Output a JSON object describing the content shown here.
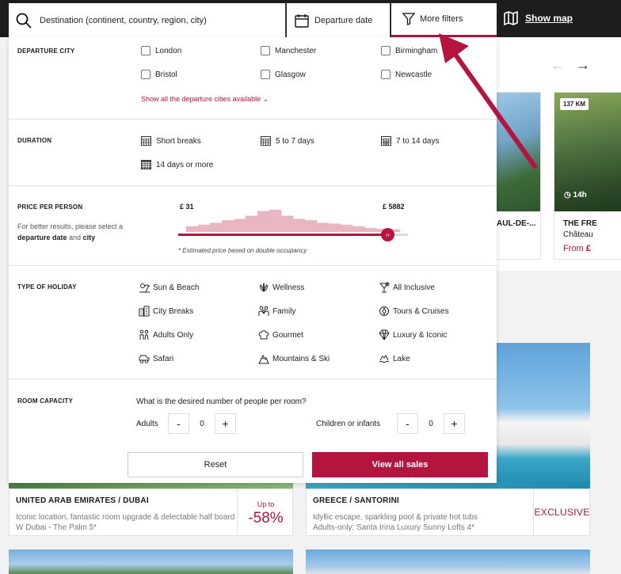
{
  "header": {
    "search_placeholder": "Destination (continent, country, region, city)",
    "departure_date": "Departure date",
    "more_filters": "More filters",
    "show_map": "Show map"
  },
  "background": {
    "card_a_title": "AUL-DE-...",
    "card_b_badge": "137 KM",
    "card_b_duration": "14h",
    "card_b_title": "THE FRE",
    "card_b_sub": "Château",
    "card_b_from": "From",
    "card_b_currency": "£",
    "deals": [
      {
        "location": "UNITED ARAB EMIRATES / DUBAI",
        "desc_line1": "Iconic location, fantastic room upgrade & delectable half board",
        "desc_line2": "W Dubai - The Palm 5*",
        "tag_small": "Up to",
        "tag_big": "-58%"
      },
      {
        "location": "GREECE / SANTORINI",
        "desc_line1": "Idyllic escape, sparkling pool & private hot tubs",
        "desc_line2": "Adults-only: Santa Irina Luxury Sunny Lofts 4*",
        "tag": "EXCLUSIVE"
      }
    ]
  },
  "filters": {
    "departure": {
      "title": "DEPARTURE CITY",
      "cities": [
        "London",
        "Manchester",
        "Birmingham",
        "Bristol",
        "Glasgow",
        "Newcastle"
      ],
      "show_all": "Show all the departure cities available"
    },
    "duration": {
      "title": "DURATION",
      "options": [
        "Short breaks",
        "5 to 7 days",
        "7 to 14 days",
        "14 days or more"
      ]
    },
    "price": {
      "title": "PRICE PER PERSON",
      "note_line1": "For better results, please select a",
      "note_bold1": "departure date",
      "note_and": "and",
      "note_bold2": "city",
      "min": "£ 31",
      "max": "£ 5882",
      "slider_max_fraction": 0.91,
      "histogram": [
        0.22,
        0.28,
        0.35,
        0.45,
        0.5,
        0.62,
        0.8,
        0.85,
        0.62,
        0.5,
        0.45,
        0.35,
        0.32,
        0.28,
        0.22,
        0.15,
        0.12,
        0.1
      ],
      "footnote": "* Estimated price based on double occupancy"
    },
    "holiday": {
      "title": "TYPE OF HOLIDAY",
      "options": [
        {
          "label": "Sun & Beach",
          "icon": "sun-beach-icon"
        },
        {
          "label": "Wellness",
          "icon": "lotus-icon"
        },
        {
          "label": "All Inclusive",
          "icon": "cocktail-icon"
        },
        {
          "label": "City Breaks",
          "icon": "city-icon"
        },
        {
          "label": "Family",
          "icon": "family-icon"
        },
        {
          "label": "Tours & Cruises",
          "icon": "compass-icon"
        },
        {
          "label": "Adults Only",
          "icon": "couple-icon"
        },
        {
          "label": "Gourmet",
          "icon": "chef-hat-icon"
        },
        {
          "label": "Luxury & Iconic",
          "icon": "diamond-icon"
        },
        {
          "label": "Safari",
          "icon": "jeep-icon"
        },
        {
          "label": "Mountains & Ski",
          "icon": "mountain-icon"
        },
        {
          "label": "Lake",
          "icon": "lake-icon"
        }
      ]
    },
    "room": {
      "title": "ROOM CAPACITY",
      "question": "What is the desired number of people per room?",
      "adults_label": "Adults",
      "adults_value": "0",
      "children_label": "Children or infants",
      "children_value": "0",
      "minus": "-",
      "plus": "+"
    },
    "actions": {
      "reset": "Reset",
      "view_all": "View all sales"
    }
  },
  "colors": {
    "accent": "#b3153f",
    "topbar": "#1d1d1d",
    "histogram": "#e8b6c2"
  }
}
